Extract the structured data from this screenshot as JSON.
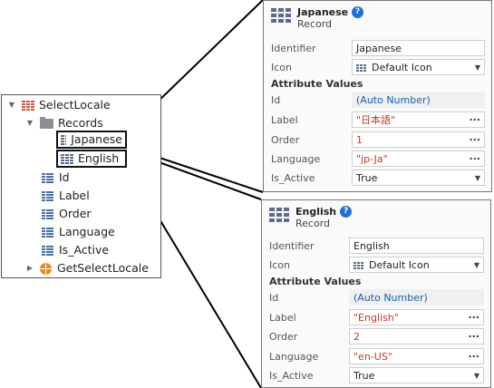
{
  "tree": {
    "root": "SelectLocale",
    "records_folder": "Records",
    "records": [
      "Japanese",
      "English"
    ],
    "attributes": [
      "Id",
      "Label",
      "Order",
      "Language",
      "Is_Active"
    ],
    "action": "GetSelectLocale"
  },
  "panels": [
    {
      "title": "Japanese",
      "subtitle": "Record",
      "help": "?",
      "identifier_label": "Identifier",
      "identifier_value": "Japanese",
      "icon_label": "Icon",
      "icon_value": "Default Icon",
      "section": "Attribute Values",
      "attrs": [
        {
          "label": "Id",
          "value": "(Auto Number)"
        },
        {
          "label": "Label",
          "value": "\"日本語\""
        },
        {
          "label": "Order",
          "value": "1"
        },
        {
          "label": "Language",
          "value": "\"jp-Ja\""
        },
        {
          "label": "Is_Active",
          "value": "True"
        }
      ]
    },
    {
      "title": "English",
      "subtitle": "Record",
      "help": "?",
      "identifier_label": "Identifier",
      "identifier_value": "English",
      "icon_label": "Icon",
      "icon_value": "Default Icon",
      "section": "Attribute Values",
      "attrs": [
        {
          "label": "Id",
          "value": "(Auto Number)"
        },
        {
          "label": "Label",
          "value": "\"English\""
        },
        {
          "label": "Order",
          "value": "2"
        },
        {
          "label": "Language",
          "value": "\"en-US\""
        },
        {
          "label": "Is_Active",
          "value": "True"
        }
      ]
    }
  ],
  "colors": {
    "string_value": "#c0392b",
    "auto_value": "#1c5fa8",
    "help_badge": "#1e6fd9",
    "action_icon": "#e8891b"
  }
}
